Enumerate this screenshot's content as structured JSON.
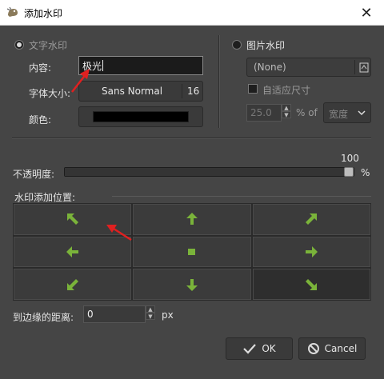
{
  "window": {
    "title": "添加水印",
    "close_glyph": "✕"
  },
  "text_watermark": {
    "label": "文字水印",
    "content_label": "内容:",
    "content_value": "极光",
    "font_label": "字体大小:",
    "font_name": "Sans Normal",
    "font_size": "16",
    "color_label": "颜色:",
    "color_value": "#000000"
  },
  "image_watermark": {
    "label": "图片水印",
    "file_value": "(None)",
    "auto_size_label": "自适应尺寸",
    "size_value": "25.0",
    "percent_of_label": "% of",
    "dimension_value": "宽度"
  },
  "opacity": {
    "label": "不透明度:",
    "value": "100",
    "unit": "%",
    "fraction": 1.0
  },
  "position": {
    "label": "水印添加位置:",
    "selected": "bottom-right"
  },
  "margin": {
    "label": "到边缘的距离:",
    "value": "0",
    "unit": "px"
  },
  "buttons": {
    "ok": "OK",
    "cancel": "Cancel"
  },
  "colors": {
    "arrow_green": "#7ab33a",
    "annotation_red": "#e02020"
  }
}
